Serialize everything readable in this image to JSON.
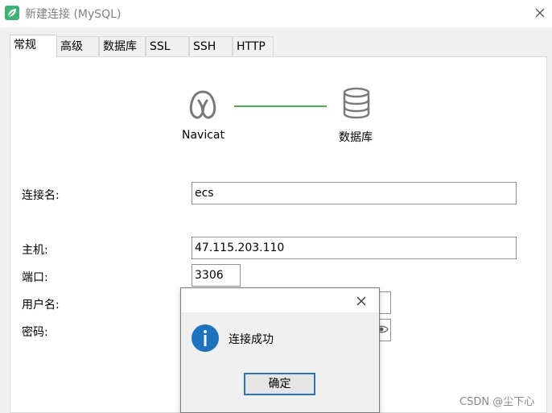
{
  "window": {
    "title": "新建连接 (MySQL)",
    "close_glyph": "✕",
    "icon": "navicat-leaf-icon"
  },
  "tabs": [
    {
      "label": "常规",
      "active": true
    },
    {
      "label": "高级",
      "active": false
    },
    {
      "label": "数据库",
      "active": false
    },
    {
      "label": "SSL",
      "active": false
    },
    {
      "label": "SSH",
      "active": false
    },
    {
      "label": "HTTP",
      "active": false
    }
  ],
  "connection": {
    "left_label": "Navicat",
    "right_label": "数据库",
    "line_color": "#4caf50"
  },
  "form": {
    "name_label": "连接名:",
    "name_value": "ecs",
    "host_label": "主机:",
    "host_value": "47.115.203.110",
    "port_label": "端口:",
    "port_value": "3306",
    "user_label": "用户名:",
    "password_label": "密码:"
  },
  "dialog": {
    "message": "连接成功",
    "ok_label": "确定",
    "close_glyph": "✕",
    "icon": "info-icon",
    "icon_color": "#1e73be"
  },
  "watermark": "CSDN @尘下心"
}
